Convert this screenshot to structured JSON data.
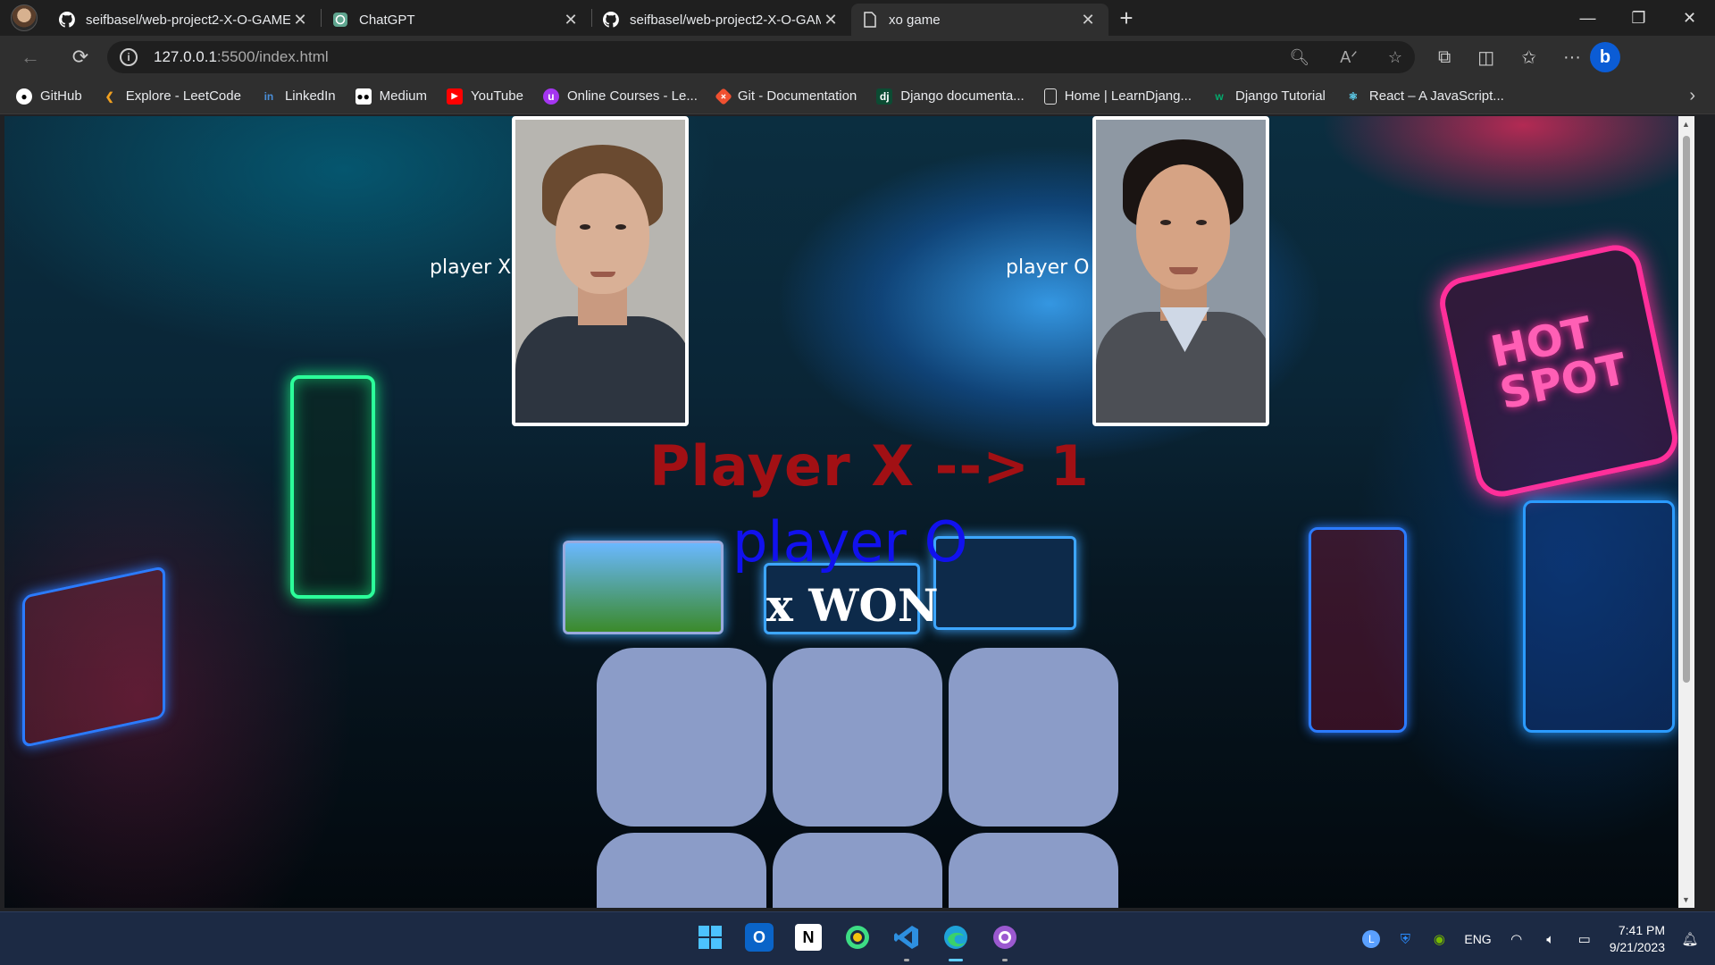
{
  "browser": {
    "tabs": [
      {
        "title": "seifbasel/web-project2-X-O-GAME",
        "icon": "github-icon",
        "active": false
      },
      {
        "title": "ChatGPT",
        "icon": "chatgpt-icon",
        "active": false
      },
      {
        "title": "seifbasel/web-project2-X-O-GAME",
        "icon": "github-icon",
        "active": false
      },
      {
        "title": "xo game",
        "icon": "page-icon",
        "active": true
      }
    ],
    "address": {
      "host": "127.0.0.1",
      "path": ":5500/index.html"
    },
    "bookmarks": [
      {
        "label": "GitHub",
        "icon": "github-icon"
      },
      {
        "label": "Explore - LeetCode",
        "icon": "leetcode-icon"
      },
      {
        "label": "LinkedIn",
        "icon": "linkedin-icon"
      },
      {
        "label": "Medium",
        "icon": "medium-icon"
      },
      {
        "label": "YouTube",
        "icon": "youtube-icon"
      },
      {
        "label": "Online Courses - Le...",
        "icon": "udemy-icon"
      },
      {
        "label": "Git - Documentation",
        "icon": "git-icon"
      },
      {
        "label": "Django documenta...",
        "icon": "django-icon"
      },
      {
        "label": "Home | LearnDjang...",
        "icon": "page-icon"
      },
      {
        "label": "Django Tutorial",
        "icon": "w3schools-icon"
      },
      {
        "label": "React – A JavaScript...",
        "icon": "react-icon"
      }
    ]
  },
  "game": {
    "player_x_label": "player X",
    "player_o_label": "player O",
    "score_x": "Player X --> 1",
    "score_o": "player O",
    "result": "x WON",
    "board": [
      "",
      "",
      "",
      "",
      "",
      ""
    ]
  },
  "taskbar": {
    "apps": [
      "windows-start-icon",
      "outlook-icon",
      "notion-icon",
      "android-studio-icon",
      "vscode-icon",
      "edge-icon",
      "github-desktop-icon"
    ],
    "language": "ENG",
    "time": "7:41 PM",
    "date": "9/21/2023"
  },
  "colors": {
    "score_x": "#a21014",
    "score_o": "#1111ee",
    "cell": "#8b9cc8"
  }
}
